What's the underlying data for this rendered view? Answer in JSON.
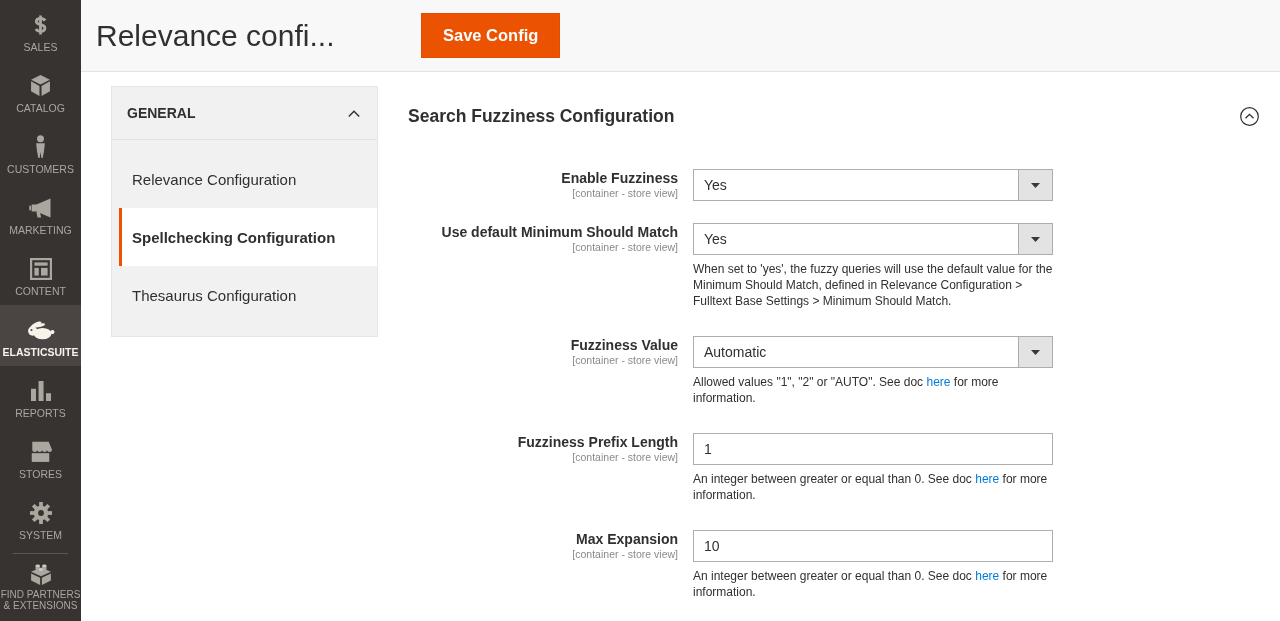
{
  "sidebar": {
    "items": [
      {
        "label": "SALES",
        "selected": false
      },
      {
        "label": "CATALOG",
        "selected": false
      },
      {
        "label": "CUSTOMERS",
        "selected": false
      },
      {
        "label": "MARKETING",
        "selected": false
      },
      {
        "label": "CONTENT",
        "selected": false
      },
      {
        "label": "ELASTICSUITE",
        "selected": true
      },
      {
        "label": "REPORTS",
        "selected": false
      },
      {
        "label": "STORES",
        "selected": false
      },
      {
        "label": "SYSTEM",
        "selected": false
      }
    ],
    "extra_items": [
      {
        "label": "FIND PARTNERS & EXTENSIONS",
        "selected": false
      }
    ]
  },
  "header": {
    "title": "Relevance confi...",
    "save_button": "Save Config"
  },
  "config_nav": {
    "group": {
      "title": "GENERAL",
      "expanded": true
    },
    "items": [
      {
        "label": "Relevance Configuration",
        "selected": false
      },
      {
        "label": "Spellchecking Configuration",
        "selected": true
      },
      {
        "label": "Thesaurus Configuration",
        "selected": false
      }
    ]
  },
  "section": {
    "title": "Search Fuzziness Configuration",
    "expanded": true,
    "fields": [
      {
        "label": "Enable Fuzziness",
        "scope": "[container - store view]",
        "kind": "select",
        "value": "Yes"
      },
      {
        "label": "Use default Minimum Should Match",
        "scope": "[container - store view]",
        "kind": "select",
        "value": "Yes",
        "comment": {
          "before": "When set to 'yes', the fuzzy queries will use the default value for the Minimum Should Match, defined in Relevance Configuration > Fulltext Base Settings > Minimum Should Match."
        }
      },
      {
        "label": "Fuzziness Value",
        "scope": "[container - store view]",
        "kind": "select",
        "value": "Automatic",
        "comment": {
          "before": "Allowed values \"1\", \"2\" or \"AUTO\". See doc ",
          "link": "here",
          "after": " for more information."
        }
      },
      {
        "label": "Fuzziness Prefix Length",
        "scope": "[container - store view]",
        "kind": "text",
        "value": "1",
        "comment": {
          "before": "An integer between greater or equal than 0. See doc ",
          "link": "here",
          "after": " for more information."
        }
      },
      {
        "label": "Max Expansion",
        "scope": "[container - store view]",
        "kind": "text",
        "value": "10",
        "comment": {
          "before": "An integer between greater or equal than 0. See doc ",
          "link": "here",
          "after": " for more information."
        }
      }
    ]
  }
}
